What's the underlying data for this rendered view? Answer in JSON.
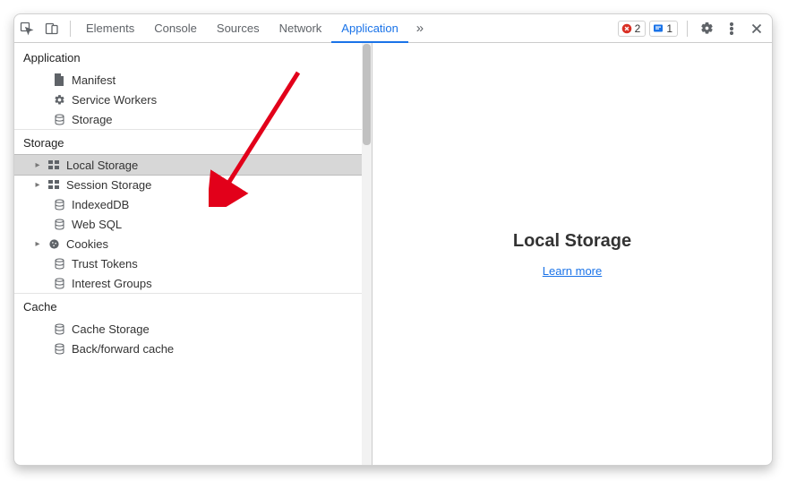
{
  "tabs": {
    "elements": "Elements",
    "console": "Console",
    "sources": "Sources",
    "network": "Network",
    "application": "Application"
  },
  "badges": {
    "error_count": "2",
    "info_count": "1"
  },
  "sections": {
    "application": {
      "title": "Application",
      "manifest": "Manifest",
      "service_workers": "Service Workers",
      "storage": "Storage"
    },
    "storage": {
      "title": "Storage",
      "local_storage": "Local Storage",
      "session_storage": "Session Storage",
      "indexeddb": "IndexedDB",
      "web_sql": "Web SQL",
      "cookies": "Cookies",
      "trust_tokens": "Trust Tokens",
      "interest_groups": "Interest Groups"
    },
    "cache": {
      "title": "Cache",
      "cache_storage": "Cache Storage",
      "bf_cache": "Back/forward cache"
    }
  },
  "main": {
    "heading": "Local Storage",
    "learn_more": "Learn more"
  }
}
